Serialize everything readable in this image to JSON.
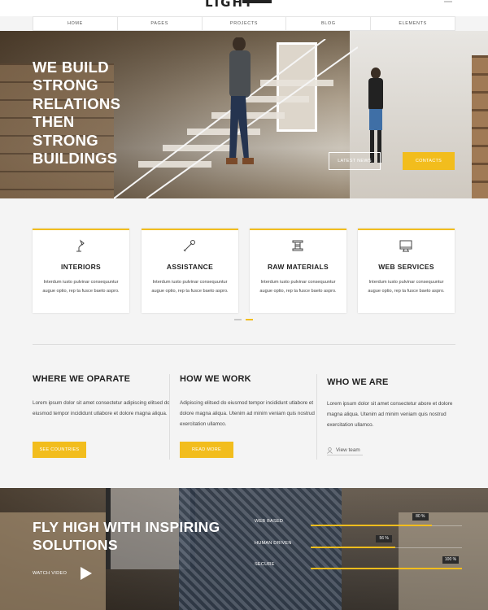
{
  "header": {
    "logo_text": "LIGHT",
    "nav": [
      "HOME",
      "PAGES",
      "PROJECTS",
      "BLOG",
      "ELEMENTS"
    ]
  },
  "hero": {
    "title_lines": [
      "WE BUILD",
      "STRONG",
      "RELATIONS",
      "THEN",
      "STRONG",
      "BUILDINGS"
    ],
    "buttons": {
      "latest_news": "LATEST NEWS",
      "contacts": "CONTACTS"
    }
  },
  "services": {
    "cards": [
      {
        "title": "INTERIORS",
        "icon": "lamp-icon",
        "text": "Interdum iusto pulvinar consequuntur augue optio, rep ta fusce baeto aspro."
      },
      {
        "title": "ASSISTANCE",
        "icon": "wrench-icon",
        "text": "Interdum iusto pulvinar consequuntur augue optio, rep ta fusce baeto aspro."
      },
      {
        "title": "RAW MATERIALS",
        "icon": "spool-icon",
        "text": "Interdum iusto pulvinar consequuntur augue optio, rep ta fusce baeto aspro."
      },
      {
        "title": "WEB SERVICES",
        "icon": "monitor-icon",
        "text": "Interdum iusto pulvinar consequuntur augue optio, rep ta fusce baeto aspro."
      }
    ],
    "pagination": {
      "count": 2,
      "active": 1
    }
  },
  "columns": [
    {
      "title": "WHERE WE OPARATE",
      "text": "Lorem ipsum dolor sit amet consectetur adipiscing elitsed do eiusmod tempor incididunt utlabore et dolore magna aliqua.",
      "button": "SEE COUNTRIES"
    },
    {
      "title": "HOW WE WORK",
      "text": "Adipiscing elitsed do eiusmod tempor incididunt utlabore et dolore magna aliqua. Utenim ad minim veniam quis nostrud exercitation ullamco.",
      "button": "READ MORE"
    },
    {
      "title": "WHO WE ARE",
      "text": "Lorem ipsum dolor sit amet consectetur abore et dolore magna aliqua. Utenim ad minim veniam quis nostrud exercitation ullamco.",
      "link": "View team"
    }
  ],
  "bottom": {
    "title_lines": [
      "FLY HIGH WITH INSPIRING",
      "SOLUTIONS"
    ],
    "watch_label": "WATCH VIDEO",
    "skills": [
      {
        "label": "WEB BASED",
        "percent": 80,
        "badge": "80 %"
      },
      {
        "label": "HUMAN DRIVEN",
        "percent": 56,
        "badge": "56 %"
      },
      {
        "label": "SECURE",
        "percent": 100,
        "badge": "100 %"
      }
    ]
  },
  "colors": {
    "accent": "#f2bd1d",
    "dark": "#222222",
    "background": "#f4f4f4"
  }
}
